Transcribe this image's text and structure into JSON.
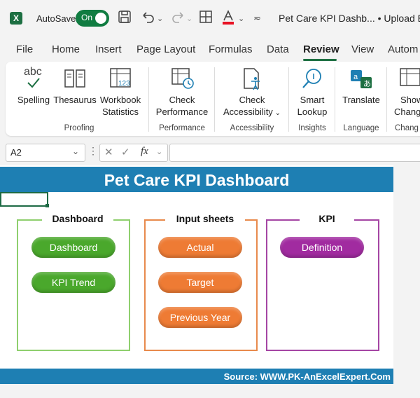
{
  "titlebar": {
    "autosave_label": "AutoSave",
    "toggle_state": "On",
    "doc_title": "Pet Care KPI Dashb...  •  Upload Bl"
  },
  "tabs": [
    {
      "label": "File"
    },
    {
      "label": "Home"
    },
    {
      "label": "Insert"
    },
    {
      "label": "Page Layout"
    },
    {
      "label": "Formulas"
    },
    {
      "label": "Data"
    },
    {
      "label": "Review"
    },
    {
      "label": "View"
    },
    {
      "label": "Autom"
    }
  ],
  "ribbon": {
    "spelling_icon_text": "abc",
    "buttons": {
      "spelling": "Spelling",
      "thesaurus": "Thesaurus",
      "workbook_statistics_1": "Workbook",
      "workbook_statistics_2": "Statistics",
      "check_performance_1": "Check",
      "check_performance_2": "Performance",
      "check_accessibility_1": "Check",
      "check_accessibility_2": "Accessibility",
      "smart_lookup_1": "Smart",
      "smart_lookup_2": "Lookup",
      "translate": "Translate",
      "show_changes_1": "Show",
      "show_changes_2": "Chang"
    },
    "groups": {
      "proofing": "Proofing",
      "performance": "Performance",
      "accessibility": "Accessibility",
      "insights": "Insights",
      "language": "Language",
      "changes": "Chang"
    }
  },
  "formula_bar": {
    "name_box": "A2",
    "fx": "fx",
    "formula": ""
  },
  "sheet": {
    "title": "Pet Care KPI Dashboard",
    "source": "Source: WWW.PK-AnExcelExpert.Com",
    "sections": {
      "dashboard": {
        "title": "Dashboard",
        "buttons": [
          "Dashboard",
          "KPI Trend"
        ]
      },
      "input_sheets": {
        "title": "Input sheets",
        "buttons": [
          "Actual",
          "Target",
          "Previous Year"
        ]
      },
      "kpi": {
        "title": "KPI",
        "buttons": [
          "Definition"
        ]
      }
    }
  },
  "colors": {
    "excel_green": "#107c41",
    "banner_blue": "#1e7fb3",
    "dashboard_green": "#4aa82c",
    "input_orange": "#ee7b34",
    "kpi_purple": "#a12ba0"
  }
}
